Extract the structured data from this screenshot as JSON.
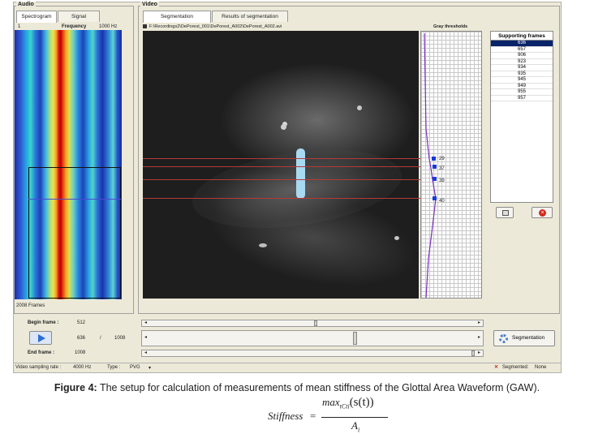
{
  "audio": {
    "group_label": "Audio",
    "tabs": [
      "Spectrogram",
      "Signal"
    ],
    "axis_left": "1",
    "axis_title": "Frequency",
    "axis_right": "1000 Hz",
    "frames_count": "2008 Frames"
  },
  "video": {
    "group_label": "Video",
    "tabs": [
      "Segmentation",
      "Results of segmentation"
    ],
    "file_path": "F:\\Recordings2\\DePorest_001\\DePorest_A002\\DePorest_A002.avi",
    "gray_title": "Gray thresholds",
    "threshold_labels": [
      "29",
      "37",
      "39",
      "40"
    ]
  },
  "supporting_frames": {
    "title": "Supporting frames",
    "items": [
      "636",
      "657",
      "906",
      "923",
      "934",
      "935",
      "945",
      "949",
      "955",
      "957"
    ],
    "selected_index": 0
  },
  "controls": {
    "begin_label": "Begin frame :",
    "begin_value": "512",
    "current_frame": "636",
    "separator": "/",
    "total_frames": "1008",
    "end_label": "End frame :",
    "end_value": "1008",
    "segmentation_button": "Segmentation"
  },
  "status_bar": {
    "sampling_label": "Video sampling rate :",
    "sampling_value": "4000 Hz",
    "type_label": "Type :",
    "type_value": "PVG",
    "segmented_label": "Segmented:",
    "segmented_value": "None"
  },
  "caption": {
    "figure_label": "Figure 4:",
    "text": "The setup for calculation of measurements of mean stiffness of the Glottal Area Waveform (GAW)."
  },
  "formula": {
    "lhs": "Stiffness",
    "equals": "=",
    "numerator": "max",
    "subscript": "tCti",
    "arg": "(s(t))",
    "denominator": "A",
    "denominator_sub": "i"
  }
}
